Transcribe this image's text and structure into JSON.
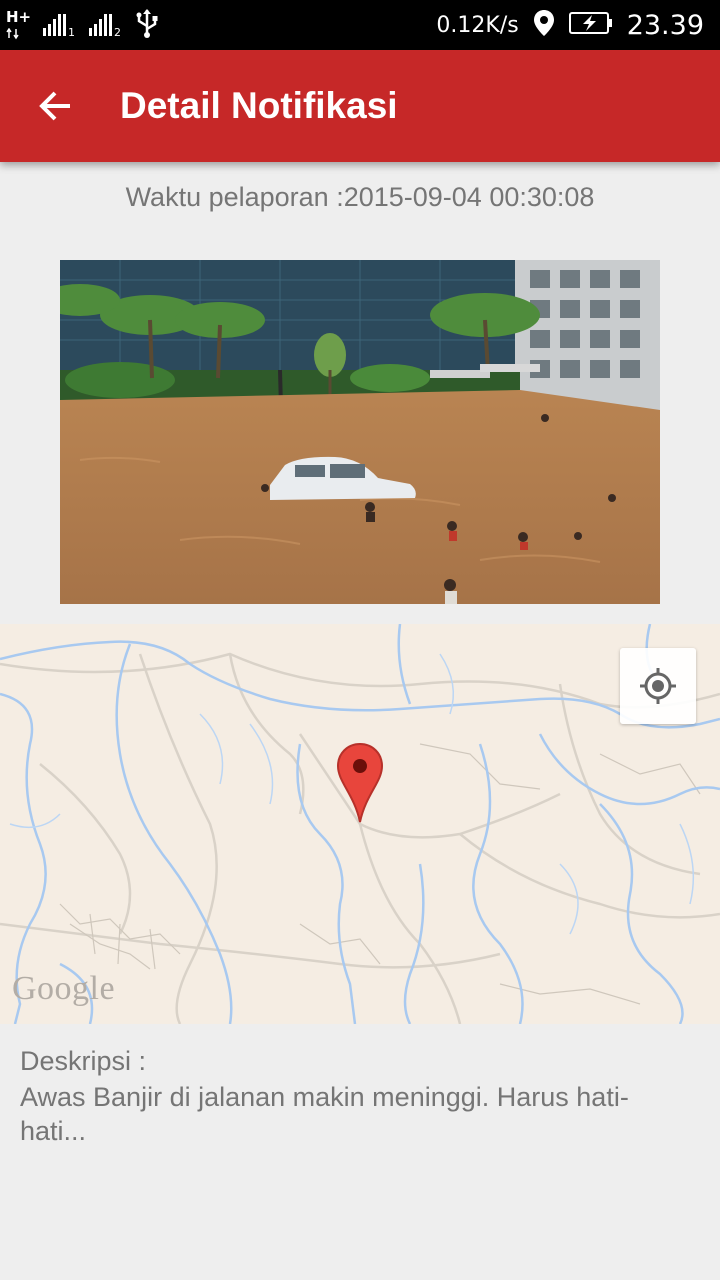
{
  "status_bar": {
    "network_type": "H+",
    "sim1_index": "1",
    "sim2_index": "2",
    "speed": "0.12K/s",
    "time": "23.39",
    "icons": [
      "signal-sim1-icon",
      "signal-sim2-icon",
      "usb-icon",
      "location-icon",
      "battery-charging-icon"
    ]
  },
  "app_bar": {
    "title": "Detail Notifikasi",
    "color": "#c62828",
    "back_icon": "arrow-back-icon"
  },
  "report": {
    "time_text": "Waktu pelaporan :2015-09-04 00:30:08"
  },
  "map": {
    "attribution": "Google",
    "marker_icon": "map-marker-icon",
    "locate_icon": "my-location-icon"
  },
  "description": {
    "label": "Deskripsi :",
    "text": "Awas Banjir di jalanan makin meninggi. Harus hati-hati..."
  }
}
